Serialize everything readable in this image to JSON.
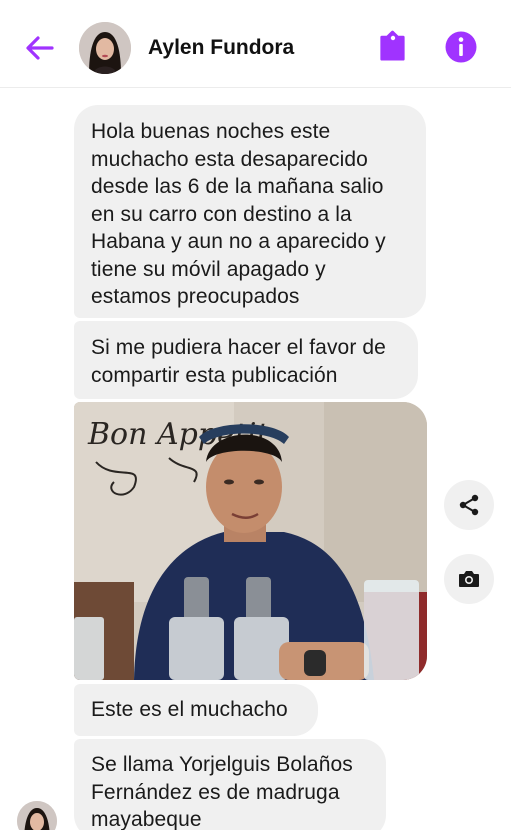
{
  "contact": {
    "name": "Aylen Fundora"
  },
  "messages": [
    {
      "text": "Hola buenas noches este muchacho esta desaparecido desde las 6 de la mañana salio en su carro con destino a la Habana y aun no a aparecido y tiene su móvil apagado y estamos preocupados"
    },
    {
      "text": "Si me pudiera hacer el favor de compartir esta publicación"
    },
    {
      "text": "Este es el muchacho"
    },
    {
      "text": "Se llama Yorjelguis Bolaños Fernández es de madruga mayabeque"
    }
  ],
  "photo": {
    "sign_text": "Bon Appetit"
  },
  "colors": {
    "accent": "#a033ff",
    "bubble": "#f0f0f0",
    "text": "#1a1a1a"
  },
  "icons": {
    "back": "arrow-left-icon",
    "tag": "tag-icon",
    "info": "info-icon",
    "share": "share-icon",
    "camera": "camera-icon"
  }
}
